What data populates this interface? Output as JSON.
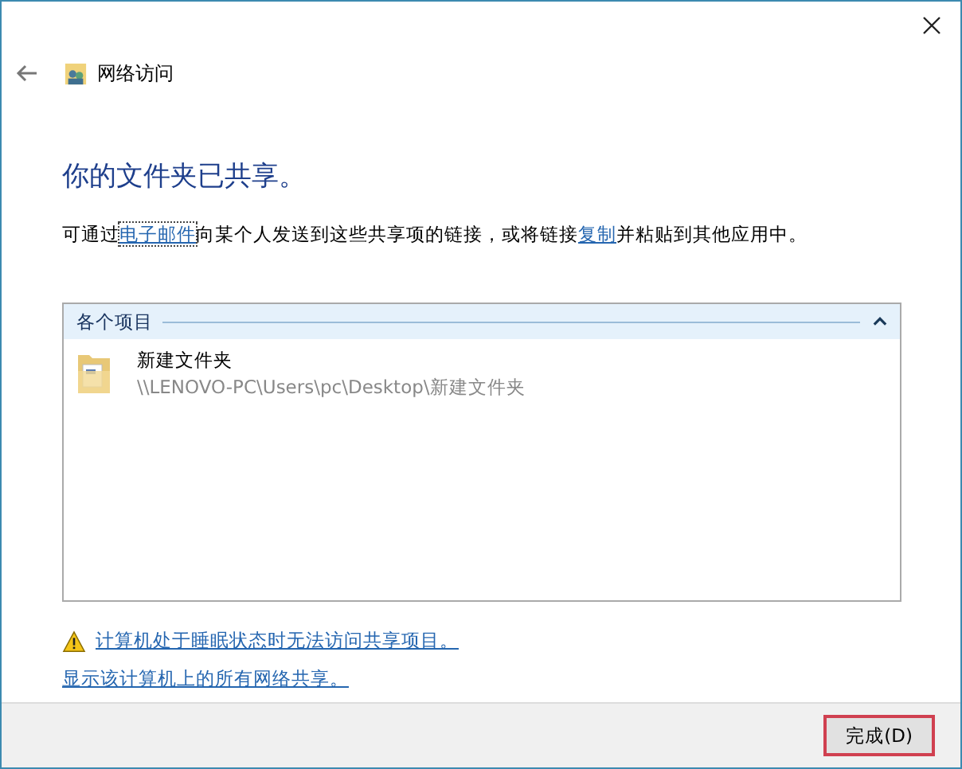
{
  "window": {
    "title": "网络访问"
  },
  "heading": "你的文件夹已共享。",
  "description": {
    "before": "可通过",
    "link_1": "电子邮件",
    "middle": "向某个人发送到这些共享项的链接，或将链接",
    "link_2": "复制",
    "after": "并粘贴到其他应用中。"
  },
  "items_panel": {
    "group_title": "各个项目",
    "expanded": true,
    "items": [
      {
        "name": "新建文件夹",
        "path": "\\\\LENOVO-PC\\Users\\pc\\Desktop\\新建文件夹"
      }
    ]
  },
  "links": [
    {
      "kind": "warning",
      "text": "计算机处于睡眠状态时无法访问共享项目。"
    },
    {
      "kind": "plain",
      "text": "显示该计算机上的所有网络共享。"
    }
  ],
  "buttons": [
    {
      "label": "完成(D)"
    }
  ]
}
